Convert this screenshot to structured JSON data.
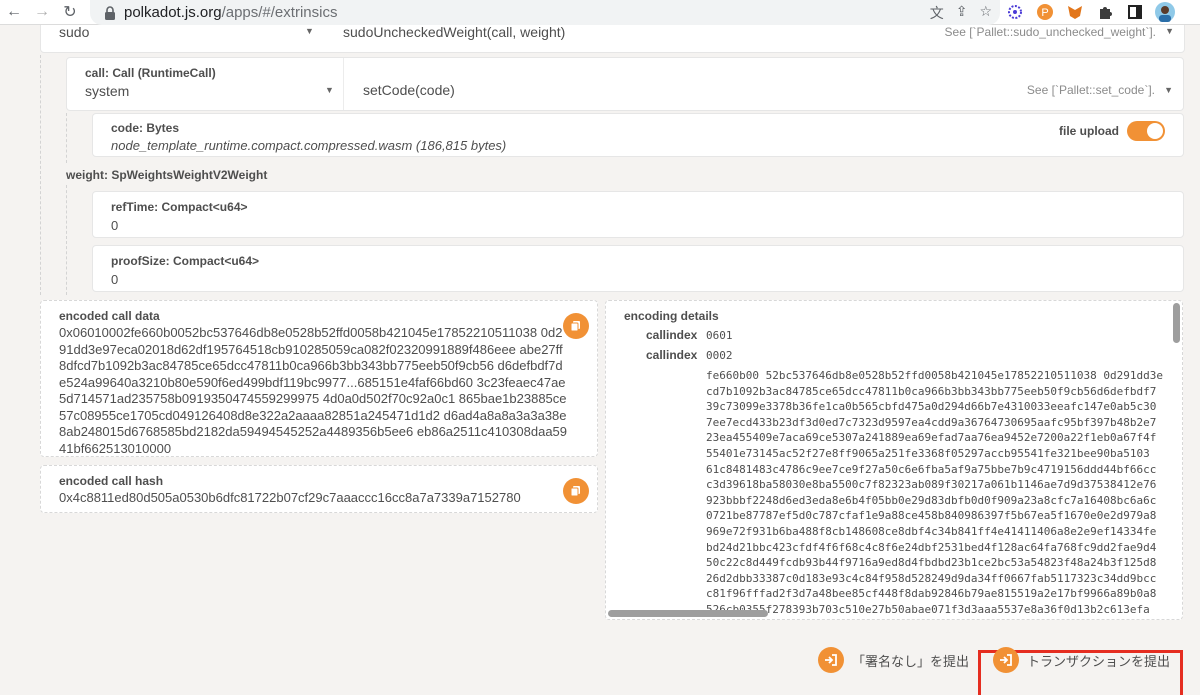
{
  "browser": {
    "url_domain": "polkadot.js.org",
    "url_path": "/apps/#/extrinsics"
  },
  "sudo_row": {
    "section": "sudo",
    "method": "sudoUncheckedWeight(call, weight)",
    "hint": "See [`Pallet::sudo_unchecked_weight`]."
  },
  "call": {
    "label": "call: Call (RuntimeCall)",
    "section": "system",
    "method": "setCode(code)",
    "hint": "See [`Pallet::set_code`]."
  },
  "code": {
    "label": "code: Bytes",
    "value": "node_template_runtime.compact.compressed.wasm (186,815 bytes)",
    "toggle_label": "file upload",
    "toggle_on": true
  },
  "weight": {
    "label": "weight: SpWeightsWeightV2Weight",
    "ref_time_label": "refTime: Compact<u64>",
    "ref_time_value": "0",
    "proof_size_label": "proofSize: Compact<u64>",
    "proof_size_value": "0"
  },
  "encoded_call_data": {
    "label": "encoded call data",
    "value": "0x06010002fe660b0052bc537646db8e0528b52ffd0058b421045e17852210511038 0d291dd3e97eca02018d62df195764518cb910285059ca082f02320991889f486eee abe27ff8dfcd7b1092b3ac84785ce65dcc47811b0ca966b3bb343bb775eeb50f9cb56 d6defbdf7de524a99640a3210b80e590f6ed499bdf119bc9977...685151e4faf66bd60 3c23feaec47ae5d714571ad235758b0919350474559299975 4d0a0d502f70c92a0c1 865bae1b23885ce57c08955ce1705cd049126408d8e322a2aaaa82851a245471d1d2 d6ad4a8a8a3a3a38e8ab248015d6768585bd2182da59494545252a4489356b5ee6 eb86a2511c410308daa5941bf662513010000"
  },
  "encoded_call_hash": {
    "label": "encoded call hash",
    "value": "0x4c8811ed80d505a0530b6dfc81722b07cf29c7aaaccc16cc8a7a7339a7152780"
  },
  "encoding_details": {
    "label": "encoding details",
    "rows": [
      {
        "label": "callindex",
        "value": "0601"
      },
      {
        "label": "callindex",
        "value": "0002"
      }
    ],
    "hex": "fe660b00 52bc537646db8e0528b52ffd0058b421045e17852210511038 0d291dd3e\ncd7b1092b3ac84785ce65dcc47811b0ca966b3bb343bb775eeb50f9cb56d6defbdf7\n39c73099e3378b36fe1ca0b565cbfd475a0d294d66b7e4310033eeafc147e0ab5c30\n7ee7ecd433b23df3d0ed7c7323d9597ea4cdd9a36764730695aafc95bf397b48b2e7\n23ea455409e7aca69ce5307a241889ea69efad7aa76ea9452e7200a22f1eb0a67f4f\n55401e73145ac52f27e8ff9065a251fe3368f05297accb95541fe321bee90ba5103\n61c8481483c4786c9ee7ce9f27a50c6e6fba5af9a75bbe7b9c4719156ddd44bf66cc\nc3d39618ba58030e8ba5500c7f82323ab089f30217a061b1146ae7d9d37538412e76\n923bbbf2248d6ed3eda8e6b4f05bb0e29d83dbfb0d0f909a23a8cfc7a16408bc6a6c\n0721be87787ef5d0c787cfaf1e9a88ce458b840986397f5b67ea5f1670e0e2d979a8\n969e72f931b6ba488f8cb148608ce8dbf4c34b841ff4e41411406a8e2e9ef14334fe\nbd24d21bbc423cfdf4f6f68c4c8f6e24dbf2531bed4f128ac64fa768fc9dd2fae9d4\n50c22c8d449fcdb93b44f9716a9ed8d4fbdbd23b1ce2bc53a54823f48a24b3f125d8\n26d2dbb33387c0d183e93c4c84f958d528249d9da34ff0667fab5117323c34dd9bcc\nc81f96fffad2f3d7a48bee85cf448f8dab92846b79ae815519a2e17bf9966a89b0a8\n526cb0355f278393b703c510e27b50abae071f3d3aaa5537e8a36f0d13b2c613efa"
  },
  "footer": {
    "unsigned_label": "「署名なし」を提出",
    "submit_label": "トランザクションを提出"
  },
  "colors": {
    "accent": "#f19135",
    "highlight": "#e52d20"
  }
}
